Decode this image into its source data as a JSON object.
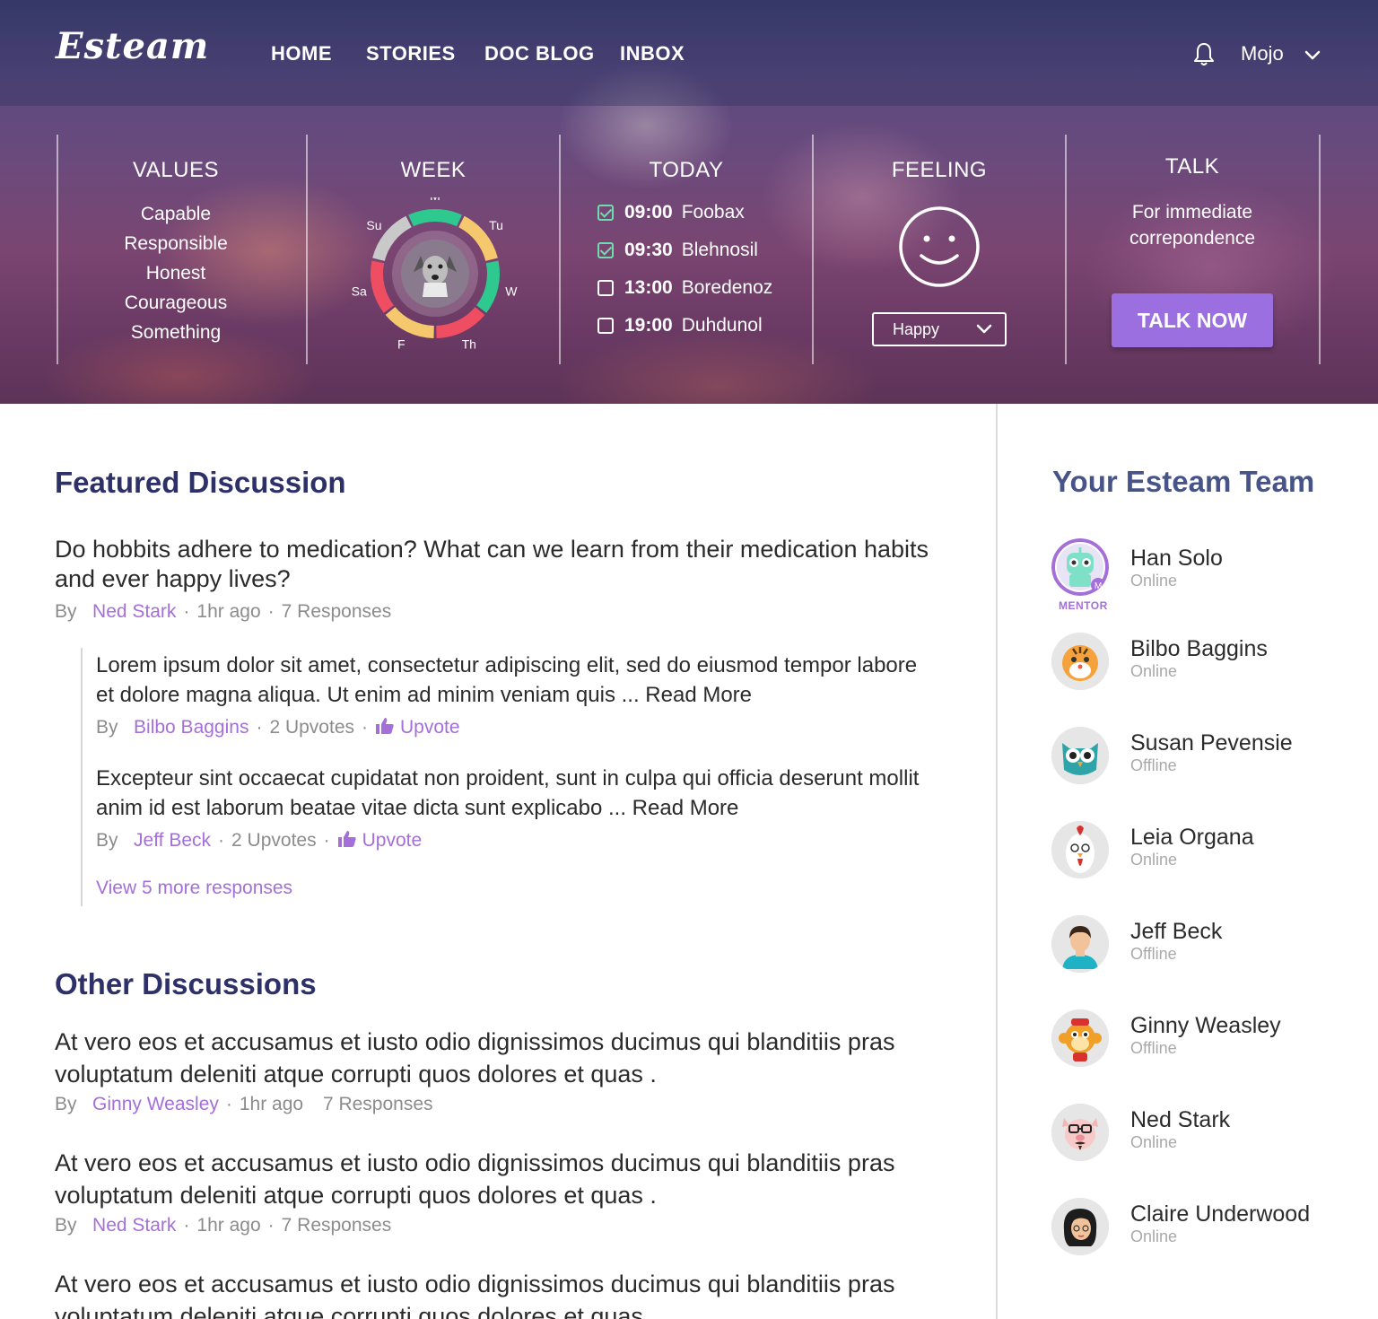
{
  "header": {
    "logo": "Esteam",
    "nav": [
      "HOME",
      "STORIES",
      "DOC BLOG",
      "INBOX"
    ],
    "user": "Mojo",
    "icons": [
      "bell-icon",
      "chevron-down-icon"
    ]
  },
  "values": {
    "title": "VALUES",
    "items": [
      "Capable",
      "Responsible",
      "Honest",
      "Courageous",
      "Something"
    ]
  },
  "week": {
    "title": "WEEK",
    "days": [
      "M",
      "Tu",
      "W",
      "Th",
      "F",
      "Sa",
      "Su"
    ],
    "segment_colors": [
      "#2ec98f",
      "#f5c86e",
      "#2ec98f",
      "#ef4d62",
      "#f5c86e",
      "#ef4d62",
      "#c9c9c9"
    ],
    "center_icon": "dog-icon"
  },
  "today": {
    "title": "TODAY",
    "items": [
      {
        "time": "09:00",
        "label": "Foobax",
        "done": true
      },
      {
        "time": "09:30",
        "label": "Blehnosil",
        "done": true
      },
      {
        "time": "13:00",
        "label": "Boredenoz",
        "done": false
      },
      {
        "time": "19:00",
        "label": "Duhdunol",
        "done": false
      }
    ]
  },
  "feeling": {
    "title": "FEELING",
    "selected": "Happy",
    "icon": "smiley-icon"
  },
  "talk": {
    "title": "TALK",
    "description": "For immediate correpondence",
    "button": "TALK NOW",
    "button_color": "#9b6fe0"
  },
  "featured": {
    "title": "Featured Discussion",
    "question": "Do hobbits adhere to medication? What can we learn from their medication habits and ever happy lives?",
    "by": "By",
    "author": "Ned Stark",
    "time": "1hr ago",
    "responses": "7 Responses",
    "replies": [
      {
        "text": "Lorem ipsum dolor sit amet, consectetur adipiscing elit, sed do eiusmod tempor labore et dolore magna aliqua. Ut enim ad minim veniam quis ... Read More",
        "by": "By",
        "author": "Bilbo Baggins",
        "upvotes": "2 Upvotes",
        "upvote": "Upvote"
      },
      {
        "text": "Excepteur sint occaecat cupidatat non proident, sunt in culpa qui officia deserunt mollit anim id est laborum beatae vitae dicta sunt explicabo ... Read More",
        "by": "By",
        "author": "Jeff Beck",
        "upvotes": "2 Upvotes",
        "upvote": "Upvote"
      }
    ],
    "view_more": "View 5 more responses"
  },
  "other": {
    "title": "Other Discussions",
    "items": [
      {
        "question": "At vero eos et accusamus et iusto odio dignissimos ducimus qui blanditiis pras voluptatum deleniti atque corrupti quos dolores et quas .",
        "by": "By",
        "author": "Ginny Weasley",
        "time": "1hr ago",
        "responses": "7 Responses"
      },
      {
        "question": "At vero eos et accusamus et iusto odio dignissimos ducimus qui blanditiis pras voluptatum deleniti atque corrupti quos dolores et quas .",
        "by": "By",
        "author": "Ned Stark",
        "time": "1hr ago",
        "responses": "7 Responses"
      },
      {
        "question": "At vero eos et accusamus et iusto odio dignissimos ducimus qui blanditiis pras voluptatum deleniti atque corrupti quos dolores et quas ."
      }
    ]
  },
  "team": {
    "title": "Your Esteam Team",
    "mentor_label": "MENTOR",
    "members": [
      {
        "name": "Han Solo",
        "status": "Online",
        "avatar": "robot-avatar-icon"
      },
      {
        "name": "Bilbo Baggins",
        "status": "Online",
        "avatar": "tiger-avatar-icon"
      },
      {
        "name": "Susan Pevensie",
        "status": "Offline",
        "avatar": "owl-avatar-icon"
      },
      {
        "name": "Leia Organa",
        "status": "Online",
        "avatar": "rooster-avatar-icon"
      },
      {
        "name": "Jeff Beck",
        "status": "Offline",
        "avatar": "person-avatar-icon"
      },
      {
        "name": "Ginny Weasley",
        "status": "Offline",
        "avatar": "monkey-avatar-icon"
      },
      {
        "name": "Ned Stark",
        "status": "Online",
        "avatar": "pig-avatar-icon"
      },
      {
        "name": "Claire Underwood",
        "status": "Online",
        "avatar": "woman-avatar-icon"
      }
    ]
  },
  "colors": {
    "accent": "#a46fd8",
    "heading": "#2e3168",
    "team_heading": "#46548a",
    "meta_gray": "#8c8c8c"
  }
}
